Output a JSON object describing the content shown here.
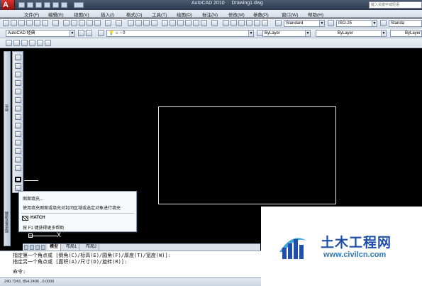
{
  "app": {
    "title": "AutoCAD 2010",
    "document": "Drawing1.dwg",
    "help_search_placeholder": "键入关键字或短语"
  },
  "menu": [
    "文件(F)",
    "编辑(E)",
    "视图(V)",
    "插入(I)",
    "格式(O)",
    "工具(T)",
    "绘图(D)",
    "标注(N)",
    "修改(M)",
    "参数(P)",
    "窗口(W)",
    "帮助(H)"
  ],
  "toolbar": {
    "workspace": "AutoCAD 经典",
    "layer": "0",
    "text_style": "Standard",
    "dim_style": "ISO-25",
    "table_style": "Standa",
    "color": "ByLayer",
    "linetype": "ByLayer",
    "lineweight": "ByLayer"
  },
  "side_strip": {
    "top_label": "特性",
    "bottom_label": "图纸集管理器"
  },
  "tooltip": {
    "title": "图案填充...",
    "description": "使用填充图案或填充对封闭区域或选定对象进行填充",
    "command": "HATCH",
    "help_hint": "按 F1 键获得更多帮助"
  },
  "layout_tabs": [
    "模型",
    "布局1",
    "布局2"
  ],
  "ucs_label": "X",
  "command_line": {
    "lines": [
      "指定第一个角点或 [倒角(C)/标高(E)/圆角(F)/厚度(T)/宽度(W)]:",
      "指定另一个角点或 [面积(A)/尺寸(D)/旋转(R)]:",
      "命令:"
    ]
  },
  "status_bar": {
    "coordinates": "240.7243,  854.2406 , 0.0000"
  },
  "watermark": {
    "title": "土木工程网",
    "url": "www.civilcn.com"
  }
}
